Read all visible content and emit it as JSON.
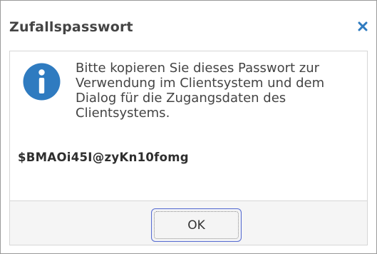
{
  "dialog": {
    "title": "Zufallspasswort",
    "close_icon": "close-icon",
    "info_icon": "info-icon",
    "message": "Bitte kopieren Sie dieses Passwort zur Verwendung im Clientsystem und dem Dialog für die Zugangsdaten des Clientsystems.",
    "password": "$BMAOi45I@zyKn10fomg",
    "ok_label": "OK"
  },
  "colors": {
    "accent": "#2f7bc0",
    "title_text": "#444444",
    "button_border": "#5a6fd0"
  }
}
